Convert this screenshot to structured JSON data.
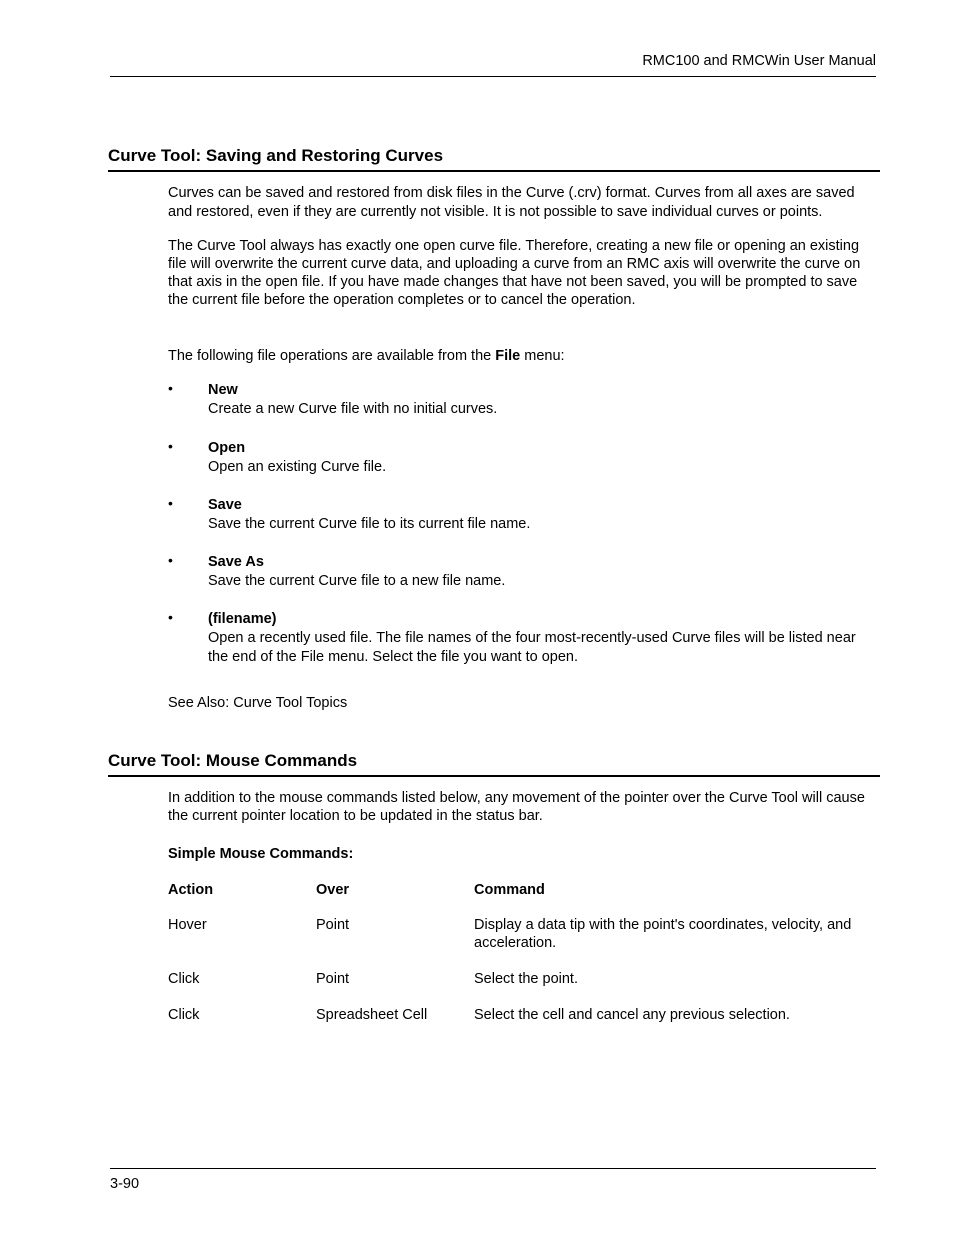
{
  "header": {
    "title": "RMC100 and RMCWin User Manual"
  },
  "section1": {
    "heading": "Curve Tool: Saving and Restoring Curves",
    "p1": "Curves can be saved and restored from disk files in the Curve (.crv) format. Curves from all axes are saved and restored, even if they are currently not visible. It is not possible to save individual curves or points.",
    "p2": "The Curve Tool always has exactly one open curve file. Therefore, creating a new file or opening an existing file will overwrite the current curve data, and uploading a curve from an RMC axis will overwrite the curve on that axis in the open file. If you have made changes that have not been saved, you will be prompted to save the current file before the operation completes or to cancel the operation.",
    "p3a": "The following file operations are available from the ",
    "p3b": "File",
    "p3c": " menu:",
    "items": [
      {
        "title": "New",
        "desc": "Create a new Curve file with no initial curves."
      },
      {
        "title": "Open",
        "desc": "Open an existing Curve file."
      },
      {
        "title": "Save",
        "desc": "Save the current Curve file to its current file name."
      },
      {
        "title": "Save As",
        "desc": "Save the current Curve file to a new file name."
      },
      {
        "title": "(filename)",
        "desc": "Open a recently used file. The file names of the four most-recently-used Curve files will be listed near the end of the File menu. Select the file you want to open."
      }
    ],
    "seealso": "See Also: Curve Tool Topics"
  },
  "section2": {
    "heading": "Curve Tool: Mouse Commands",
    "intro": "In addition to the mouse commands listed below, any movement of the pointer over the Curve Tool will cause the current pointer location to be updated in the status bar.",
    "tableTitle": "Simple Mouse Commands:",
    "cols": {
      "action": "Action",
      "over": "Over",
      "command": "Command"
    },
    "rows": [
      {
        "action": "Hover",
        "over": "Point",
        "command": "Display a data tip with the point's coordinates, velocity, and acceleration."
      },
      {
        "action": "Click",
        "over": "Point",
        "command": "Select the point."
      },
      {
        "action": "Click",
        "over": "Spreadsheet Cell",
        "command": "Select the cell and cancel any previous selection."
      }
    ]
  },
  "footer": {
    "pagenum": "3-90"
  }
}
